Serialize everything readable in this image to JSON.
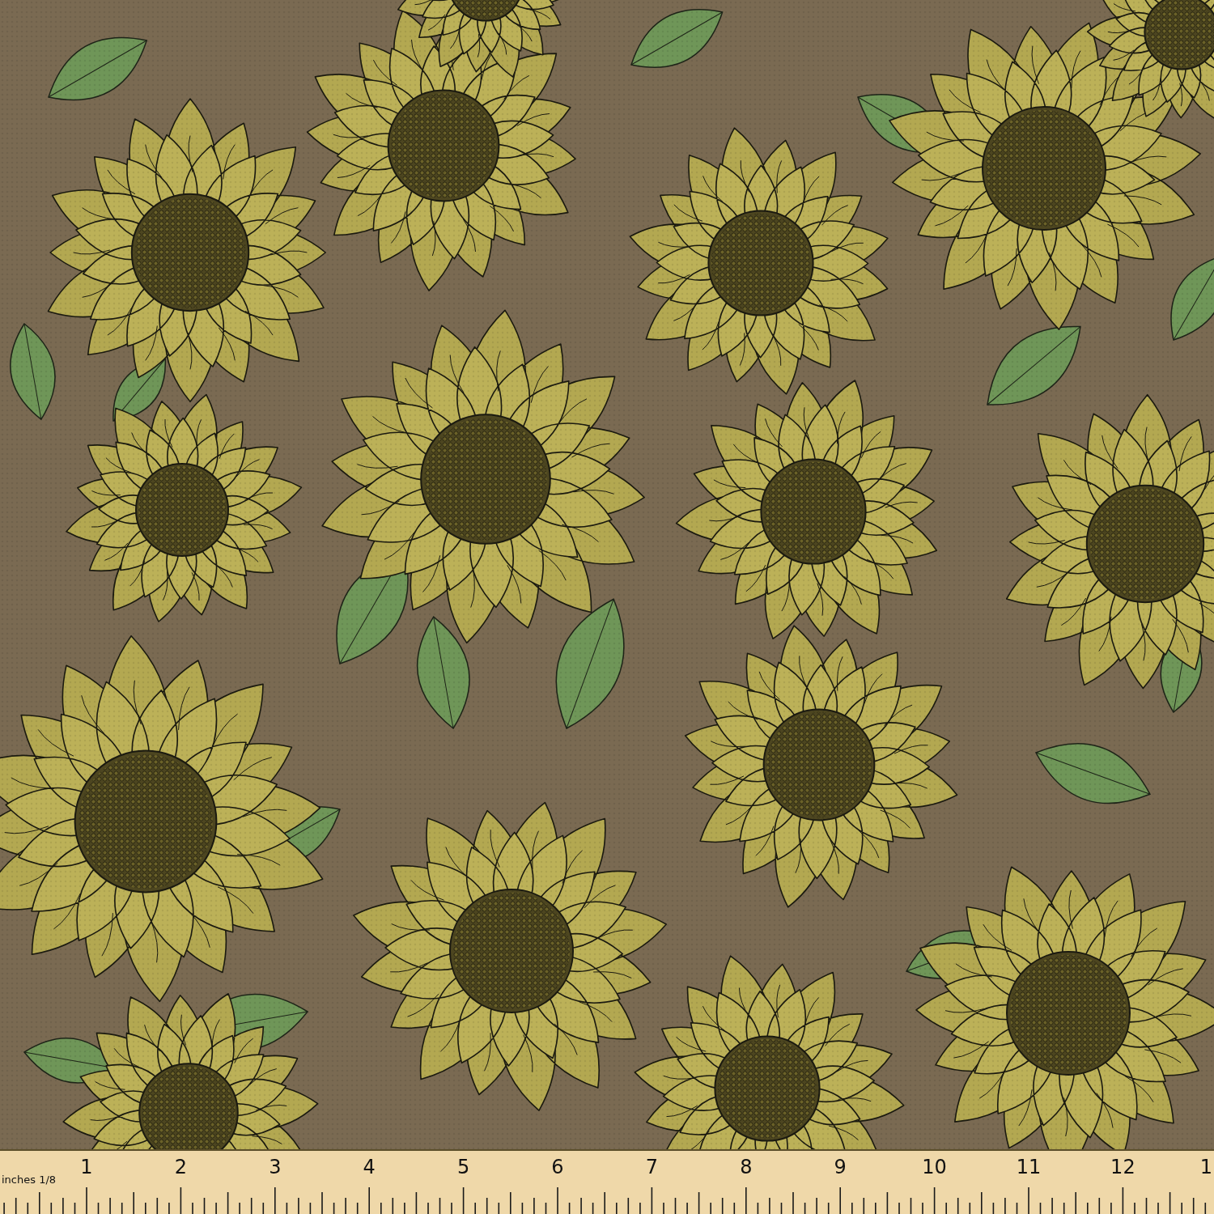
{
  "ruler": {
    "unit_label": "inches 1/8",
    "numbers": [
      "1",
      "2",
      "3",
      "4",
      "5",
      "6",
      "7",
      "8",
      "9",
      "10",
      "11",
      "12",
      "1"
    ]
  }
}
